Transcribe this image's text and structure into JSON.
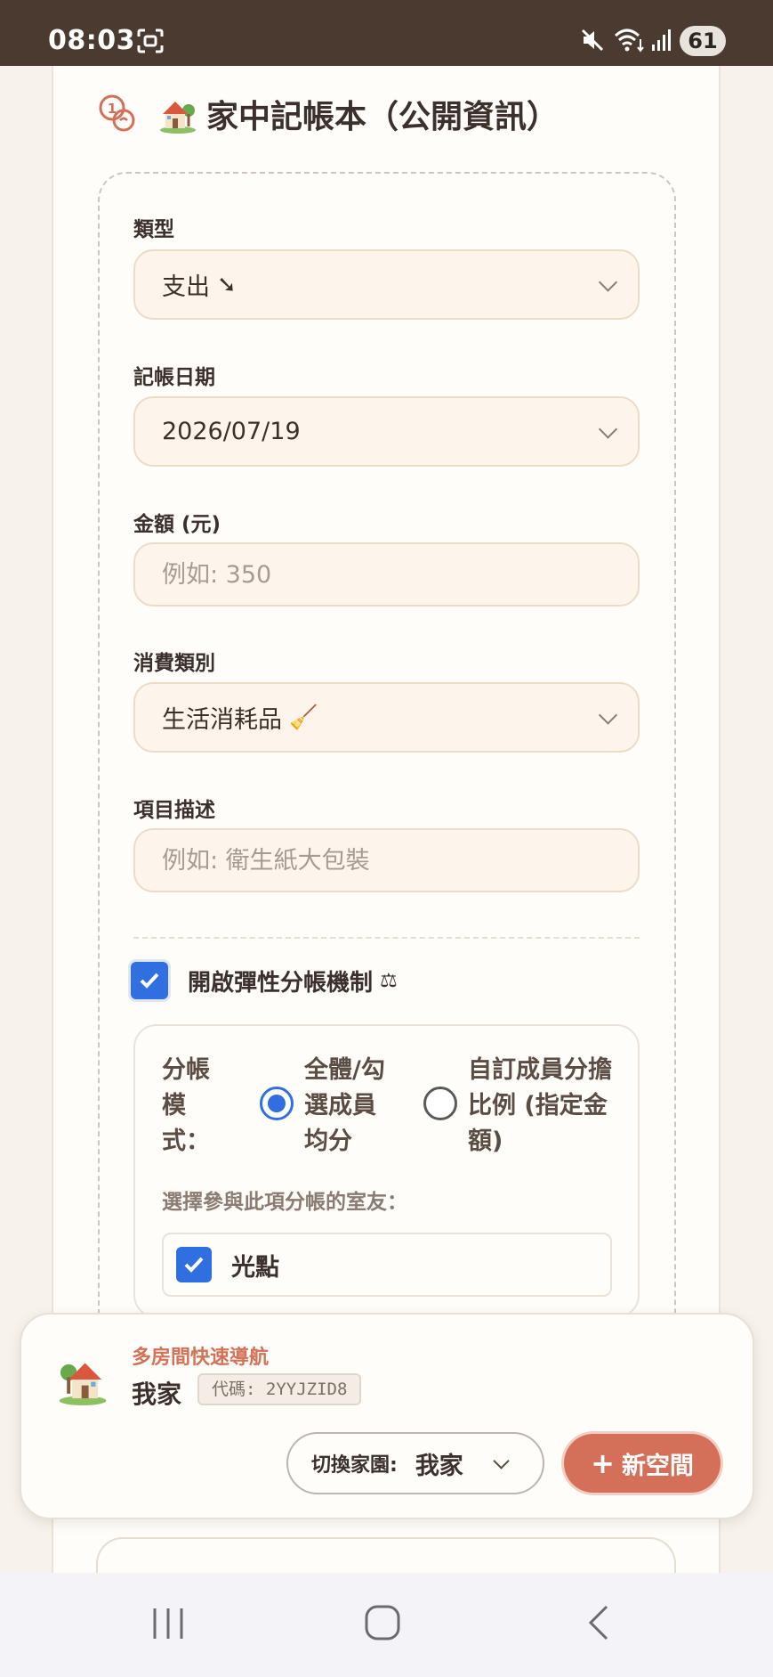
{
  "status_bar": {
    "time": "08:03",
    "battery": "61"
  },
  "app": {
    "title": "家中記帳本（公開資訊）"
  },
  "form": {
    "type": {
      "label": "類型",
      "value": "支出",
      "emoji": "➘"
    },
    "date": {
      "label": "記帳日期",
      "value": "2026/07/19"
    },
    "amount": {
      "label": "金額 (元)",
      "placeholder": "例如: 350"
    },
    "category": {
      "label": "消費類別",
      "value": "生活消耗品",
      "emoji": "🧹"
    },
    "description": {
      "label": "項目描述",
      "placeholder": "例如: 衛生紙大包裝"
    },
    "split_toggle": {
      "label": "開啟彈性分帳機制",
      "emoji": "⚖"
    },
    "split": {
      "mode_label": "分帳模式：",
      "options": [
        {
          "label": "全體/勾選成員均分",
          "selected": true
        },
        {
          "label": "自訂成員分擔比例 (指定金額)",
          "selected": false
        }
      ],
      "participants_label": "選擇參與此項分帳的室友：",
      "members": [
        {
          "name": "光點",
          "checked": true
        }
      ]
    }
  },
  "room_nav": {
    "title": "多房間快速導航",
    "current_home": "我家",
    "code": "代碼: 2YYJZID8",
    "switch_label": "切換家園:",
    "switch_value": "我家",
    "new_space_label": "新空間"
  },
  "colors": {
    "accent": "#d47059",
    "primary_blue": "#2f6fe0",
    "status_bar": "#4a3a30"
  }
}
